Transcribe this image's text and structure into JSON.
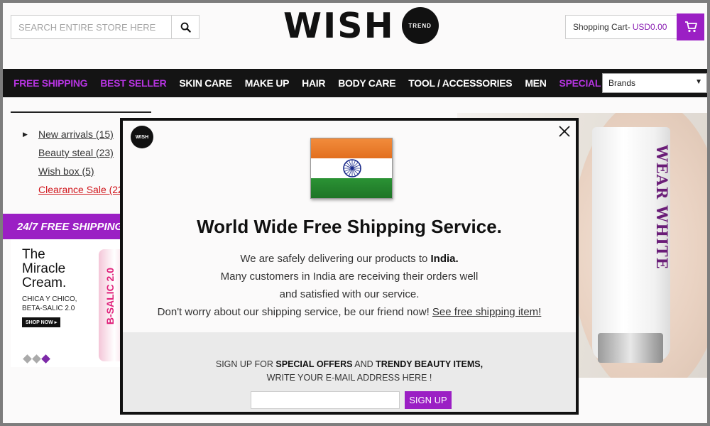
{
  "search": {
    "placeholder": "SEARCH ENTIRE STORE HERE"
  },
  "logo": {
    "text": "WISH",
    "badge": "TREND"
  },
  "cart": {
    "label": "Shopping Cart-",
    "value": "USD0.00"
  },
  "nav": {
    "items": [
      {
        "label": "FREE SHIPPING",
        "accent": true
      },
      {
        "label": "BEST SELLER",
        "accent": true
      },
      {
        "label": "SKIN CARE",
        "accent": false
      },
      {
        "label": "MAKE UP",
        "accent": false
      },
      {
        "label": "HAIR",
        "accent": false
      },
      {
        "label": "BODY CARE",
        "accent": false
      },
      {
        "label": "TOOL / ACCESSORIES",
        "accent": false
      },
      {
        "label": "MEN",
        "accent": false
      },
      {
        "label": "SPECIAL",
        "accent": true
      }
    ],
    "brands_label": "Brands"
  },
  "sidebar": {
    "items": [
      {
        "label": "New arrivals (15)"
      },
      {
        "label": "Beauty steal (23)"
      },
      {
        "label": "Wish box (5)"
      },
      {
        "label": "Clearance Sale (22"
      }
    ]
  },
  "banner": {
    "text": "24/7 FREE SHIPPING Z"
  },
  "promo": {
    "title_lines": [
      "The",
      "Miracle",
      "Cream."
    ],
    "sub_lines": [
      "CHICA Y CHICO,",
      "BETA-SALIC 2.0"
    ],
    "shop_now": "SHOP NOW ▸",
    "tube_text": "B-SALIC 2.0"
  },
  "hero": {
    "brand": "WEAR WHITE"
  },
  "modal": {
    "logo_text": "WISH",
    "headline": "World Wide Free Shipping Service.",
    "line1_pre": "We are safely delivering our products to ",
    "line1_bold": "India.",
    "line2": "Many customers in India are receiving their orders well",
    "line3": "and satisfied with our service.",
    "line4_pre": "Don't worry about our shipping service, be our friend now! ",
    "line4_link": "See free shipping item!",
    "signup_line1_a": "SIGN UP FOR ",
    "signup_line1_b": "SPECIAL OFFERS",
    "signup_line1_c": " AND ",
    "signup_line1_d": "TRENDY BEAUTY ITEMS,",
    "signup_line2": "WRITE YOUR E-MAIL ADDRESS HERE !",
    "email_placeholder": "",
    "signup_button": "SIGN UP"
  },
  "colors": {
    "accent": "#9b1fc4",
    "nav_bg": "#141414",
    "sale_red": "#d0161c"
  },
  "icons": [
    "search-icon",
    "cart-icon",
    "close-icon",
    "caret-down-icon",
    "india-flag-icon"
  ]
}
